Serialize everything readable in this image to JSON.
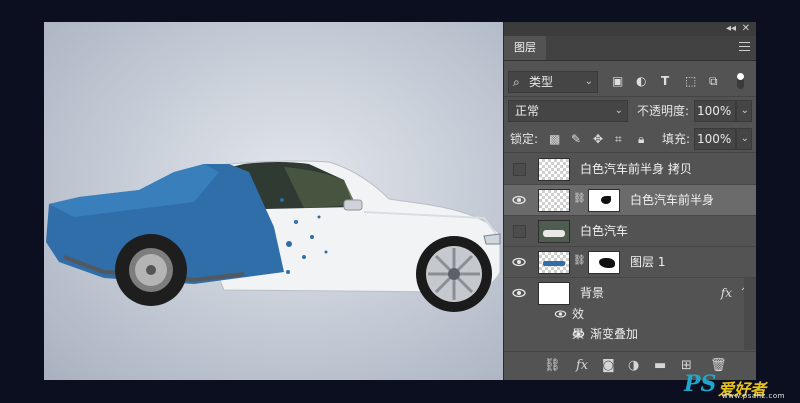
{
  "panel": {
    "top_buttons": {
      "collapse": "◂◂",
      "close": "✕"
    },
    "tab_label": "图层",
    "filter": {
      "search_glyph": "⌕",
      "kind_label": "类型"
    },
    "blend": {
      "mode": "正常",
      "opacity_label": "不透明度:",
      "opacity_value": "100%"
    },
    "lock": {
      "label": "锁定:",
      "fill_label": "填充:",
      "fill_value": "100%"
    },
    "layers": [
      {
        "name": "白色汽车前半身 拷贝",
        "visible": false
      },
      {
        "name": "白色汽车前半身",
        "visible": true,
        "selected": true,
        "has_mask": true
      },
      {
        "name": "白色汽车",
        "visible": false
      },
      {
        "name": "图层 1",
        "visible": true,
        "has_mask": true
      },
      {
        "name": "背景",
        "visible": true,
        "fx": "fx"
      }
    ],
    "effects_label": "效果",
    "effect_item": "渐变叠加",
    "bottom_icons": [
      "link-layers-icon",
      "fx-icon",
      "add-mask-icon",
      "adjustment-layer-icon",
      "new-group-icon",
      "new-layer-icon",
      "delete-icon"
    ],
    "bottom_fx": "fx"
  },
  "watermark": {
    "brand": "PS",
    "name": "爱好者",
    "url": "www.psahz.com"
  }
}
